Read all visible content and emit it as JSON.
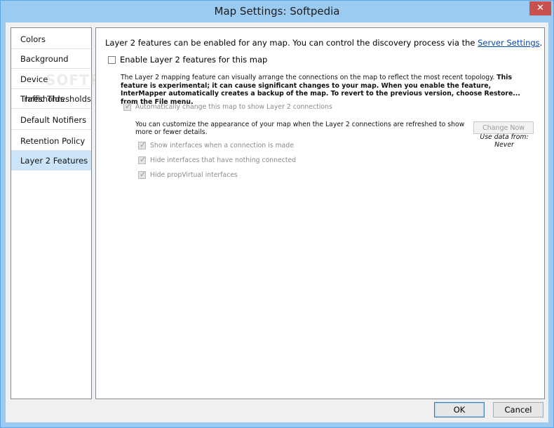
{
  "window": {
    "title": "Map Settings: Softpedia",
    "close_glyph": "✕"
  },
  "sidebar": {
    "items": [
      {
        "label": "Colors"
      },
      {
        "label": "Background"
      },
      {
        "label": "Device Thresholds"
      },
      {
        "label": "Traffic Thresholds"
      },
      {
        "label": "Default Notifiers"
      },
      {
        "label": "Retention Policy"
      },
      {
        "label": "Layer 2 Features",
        "selected": true
      }
    ]
  },
  "panel": {
    "intro_text": "Layer 2 features can be enabled for any map.  You can control the discovery process via the ",
    "intro_link": "Server Settings",
    "intro_end": ".",
    "enable_checkbox": {
      "label": "Enable Layer 2 features for this map",
      "checked": false
    },
    "description_plain": "The Layer 2 mapping feature can visually arrange the connections on the map to reflect the most recent topology. ",
    "description_bold": "This feature is experimental; it can cause significant changes to your map. When you enable the feature, InterMapper automatically creates a backup of the map. To revert to the previous version, choose Restore... from the File menu.",
    "auto_change": {
      "label": "Automatically change this map to show Layer 2 connections",
      "checked": true,
      "disabled": true
    },
    "customize_text": "You can customize the appearance of your map when the Layer 2 connections are refreshed to show more or fewer details.",
    "change_now_button": "Change Now",
    "use_data_label": "Use data from:",
    "use_data_value": "Never",
    "options": [
      {
        "label": "Show interfaces when a connection is made",
        "checked": true,
        "disabled": true
      },
      {
        "label": "Hide interfaces that have nothing connected",
        "checked": true,
        "disabled": true
      },
      {
        "label": "Hide propVirtual interfaces",
        "checked": true,
        "disabled": true
      }
    ]
  },
  "buttons": {
    "ok": "OK",
    "cancel": "Cancel"
  },
  "watermark": "SOFTPEDIA",
  "colors": {
    "title_bar": "#9ccbf2",
    "selected_item": "#cce4f7",
    "link": "#0645ad"
  }
}
